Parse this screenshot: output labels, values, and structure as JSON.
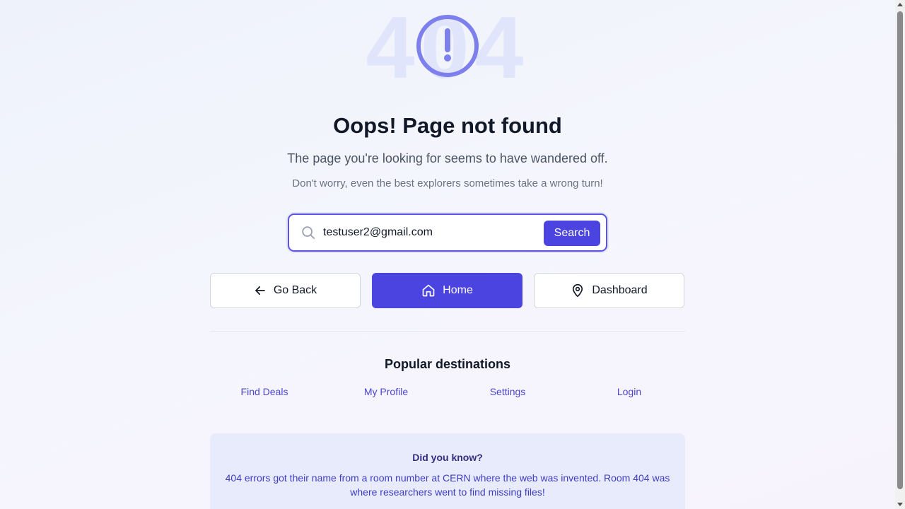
{
  "hero": {
    "code": "404"
  },
  "heading": "Oops! Page not found",
  "subtitle": "The page you're looking for seems to have wandered off.",
  "subtitle2": "Don't worry, even the best explorers sometimes take a wrong turn!",
  "search": {
    "value": "testuser2@gmail.com",
    "button_label": "Search"
  },
  "actions": {
    "back_label": "Go Back",
    "home_label": "Home",
    "dashboard_label": "Dashboard"
  },
  "popular": {
    "title": "Popular destinations",
    "links": [
      "Find Deals",
      "My Profile",
      "Settings",
      "Login"
    ]
  },
  "fact": {
    "title": "Did you know?",
    "text": "404 errors got their name from a room number at CERN where the web was invented. Room 404 was where researchers went to find missing files!"
  },
  "colors": {
    "accent": "#4c44e0",
    "hero_text": "#e0e5fb",
    "hero_icon": "#7d80ec",
    "link": "#4c44d2",
    "fact_bg": "#e8ebfb"
  },
  "icons": {
    "hero": "alert-circle-icon",
    "search": "search-icon",
    "back": "arrow-left-icon",
    "home": "home-icon",
    "dashboard": "map-pin-icon"
  }
}
